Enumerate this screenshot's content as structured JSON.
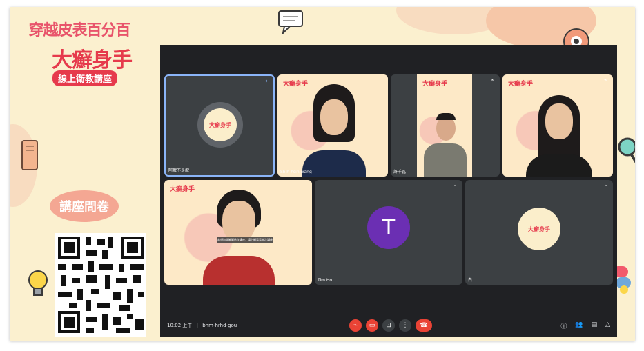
{
  "event": {
    "title_line1_a": "穿越皮表",
    "title_line1_b": "百分百",
    "title_line2": "大癬身手",
    "title_line3": "線上衛教講座",
    "survey_label": "講座問卷"
  },
  "tiles": [
    {
      "name": "阿癬不是癬",
      "type": "logo"
    },
    {
      "name": "Shih-hsin wang",
      "type": "video"
    },
    {
      "name": "許千瓦",
      "type": "video"
    },
    {
      "name": "",
      "type": "video"
    },
    {
      "name": "",
      "type": "video"
    },
    {
      "name": "Tim Ho",
      "type": "avatar",
      "initial": "T"
    },
    {
      "name": "白",
      "type": "logo"
    }
  ],
  "poster_label": "大癬身手",
  "caption_text": "若想加強瞭解這次講座，請上網看看本次講座",
  "meeting": {
    "time": "10:02 上午",
    "separator": "|",
    "code": "bnm-hrhd-gou"
  },
  "colors": {
    "background": "#fbf0cf",
    "meet_bg": "#202124",
    "tile_bg": "#3c4043",
    "end_call": "#ea4335",
    "avatar": "#6b2fb3"
  }
}
